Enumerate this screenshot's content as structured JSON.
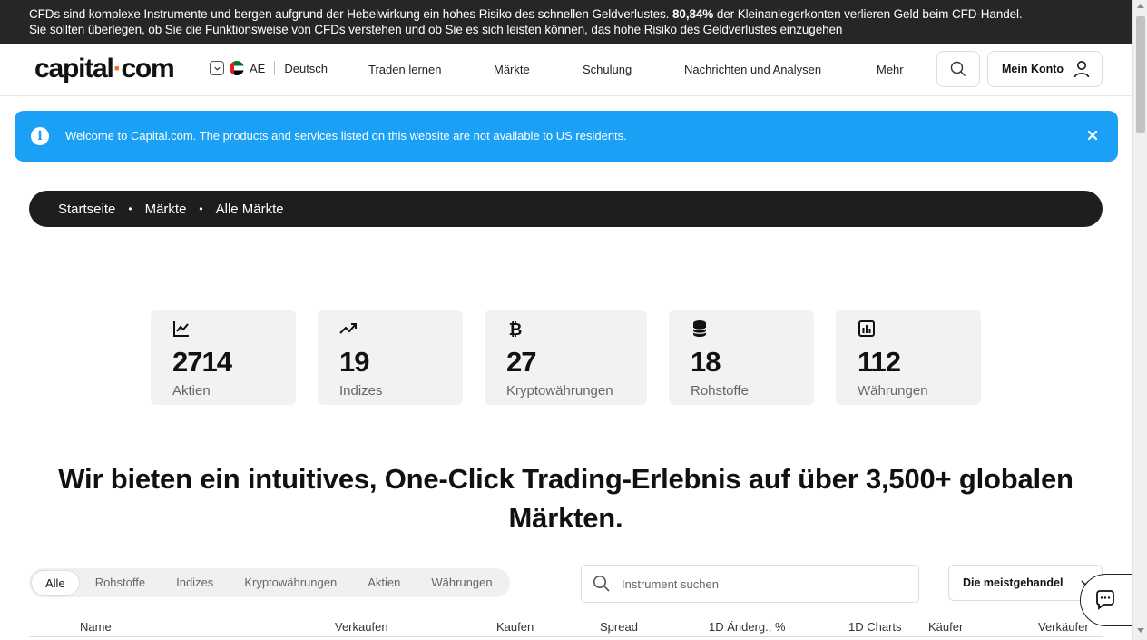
{
  "risk_banner": {
    "part1": "CFDs sind komplexe Instrumente und bergen aufgrund der Hebelwirkung ein hohes Risiko des schnellen Geldverlustes. ",
    "percent": "80,84%",
    "part2": " der Kleinanlegerkonten verlieren Geld beim CFD-Handel.",
    "line2": "Sie sollten überlegen, ob Sie die Funktionsweise von CFDs verstehen und ob Sie es sich leisten können, das hohe Risiko des Geldverlustes einzugehen"
  },
  "header": {
    "logo_left": "capital",
    "logo_dot": "·",
    "logo_right": "com",
    "region": "AE",
    "language": "Deutsch",
    "nav": [
      "Traden lernen",
      "Märkte",
      "Schulung",
      "Nachrichten und Analysen",
      "Mehr"
    ],
    "account_label": "Mein Konto"
  },
  "info_banner": {
    "icon": "info-icon",
    "message": "Welcome to Capital.com. The products and services listed on this website are not available to US residents."
  },
  "breadcrumb": [
    "Startseite",
    "Märkte",
    "Alle Märkte"
  ],
  "stats": [
    {
      "icon": "stocks-chart-icon",
      "count": "2714",
      "label": "Aktien"
    },
    {
      "icon": "trending-up-icon",
      "count": "19",
      "label": "Indizes"
    },
    {
      "icon": "bitcoin-icon",
      "count": "27",
      "label": "Kryptowährungen"
    },
    {
      "icon": "coins-stack-icon",
      "count": "18",
      "label": "Rohstoffe"
    },
    {
      "icon": "bar-chart-icon",
      "count": "112",
      "label": "Währungen"
    }
  ],
  "headline": {
    "line1": "Wir bieten ein intuitives, One-Click Trading-Erlebnis auf über 3,500+ globalen",
    "line2": "Märkten."
  },
  "filters": {
    "tabs": [
      "Alle",
      "Rohstoffe",
      "Indizes",
      "Kryptowährungen",
      "Aktien",
      "Währungen"
    ],
    "active_tab": "Alle",
    "search_placeholder": "Instrument suchen",
    "sort_value": "Die meistgehandel"
  },
  "table": {
    "columns": [
      "Name",
      "Verkaufen",
      "Kaufen",
      "Spread",
      "1D Änderg., %",
      "1D Charts",
      "Käufer",
      "Verkäufer"
    ]
  },
  "colors": {
    "banner_bg": "#262626",
    "info_bg": "#1aa0f5",
    "logo_dot": "#f06e2a",
    "card_bg": "#f2f2f3"
  }
}
